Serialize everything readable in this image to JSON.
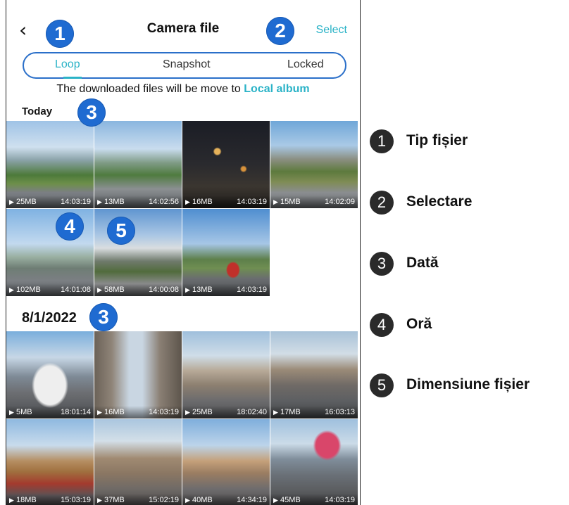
{
  "header": {
    "back_icon": "chevron-left-icon",
    "title": "Camera file",
    "select_label": "Select"
  },
  "tabs": [
    {
      "label": "Loop",
      "active": true
    },
    {
      "label": "Snapshot",
      "active": false
    },
    {
      "label": "Locked",
      "active": false
    }
  ],
  "notice": {
    "text": "The downloaded files will be move to",
    "link": "Local album"
  },
  "sections": [
    {
      "label": "Today",
      "items": [
        {
          "size": "25MB",
          "time": "14:03:19"
        },
        {
          "size": "13MB",
          "time": "14:02:56"
        },
        {
          "size": "16MB",
          "time": "14:03:19"
        },
        {
          "size": "15MB",
          "time": "14:02:09"
        },
        {
          "size": "102MB",
          "time": "14:01:08"
        },
        {
          "size": "58MB",
          "time": "14:00:08"
        },
        {
          "size": "13MB",
          "time": "14:03:19"
        }
      ]
    },
    {
      "label": "8/1/2022",
      "items": [
        {
          "size": "5MB",
          "time": "18:01:14"
        },
        {
          "size": "16MB",
          "time": "14:03:19"
        },
        {
          "size": "25MB",
          "time": "18:02:40"
        },
        {
          "size": "17MB",
          "time": "16:03:13"
        },
        {
          "size": "18MB",
          "time": "15:03:19"
        },
        {
          "size": "37MB",
          "time": "15:02:19"
        },
        {
          "size": "40MB",
          "time": "14:34:19"
        },
        {
          "size": "45MB",
          "time": "14:03:19"
        }
      ]
    }
  ],
  "callouts": [
    "1",
    "2",
    "3",
    "3",
    "4",
    "5"
  ],
  "legend": [
    {
      "num": "1",
      "label": "Tip fișier"
    },
    {
      "num": "2",
      "label": "Selectare"
    },
    {
      "num": "3",
      "label": "Dată"
    },
    {
      "num": "4",
      "label": "Oră"
    },
    {
      "num": "5",
      "label": "Dimensiune fișier"
    }
  ],
  "colors": {
    "accent": "#2bb3c7",
    "callout_blue": "#1f6bd1",
    "legend_dark": "#2a2a2a"
  }
}
